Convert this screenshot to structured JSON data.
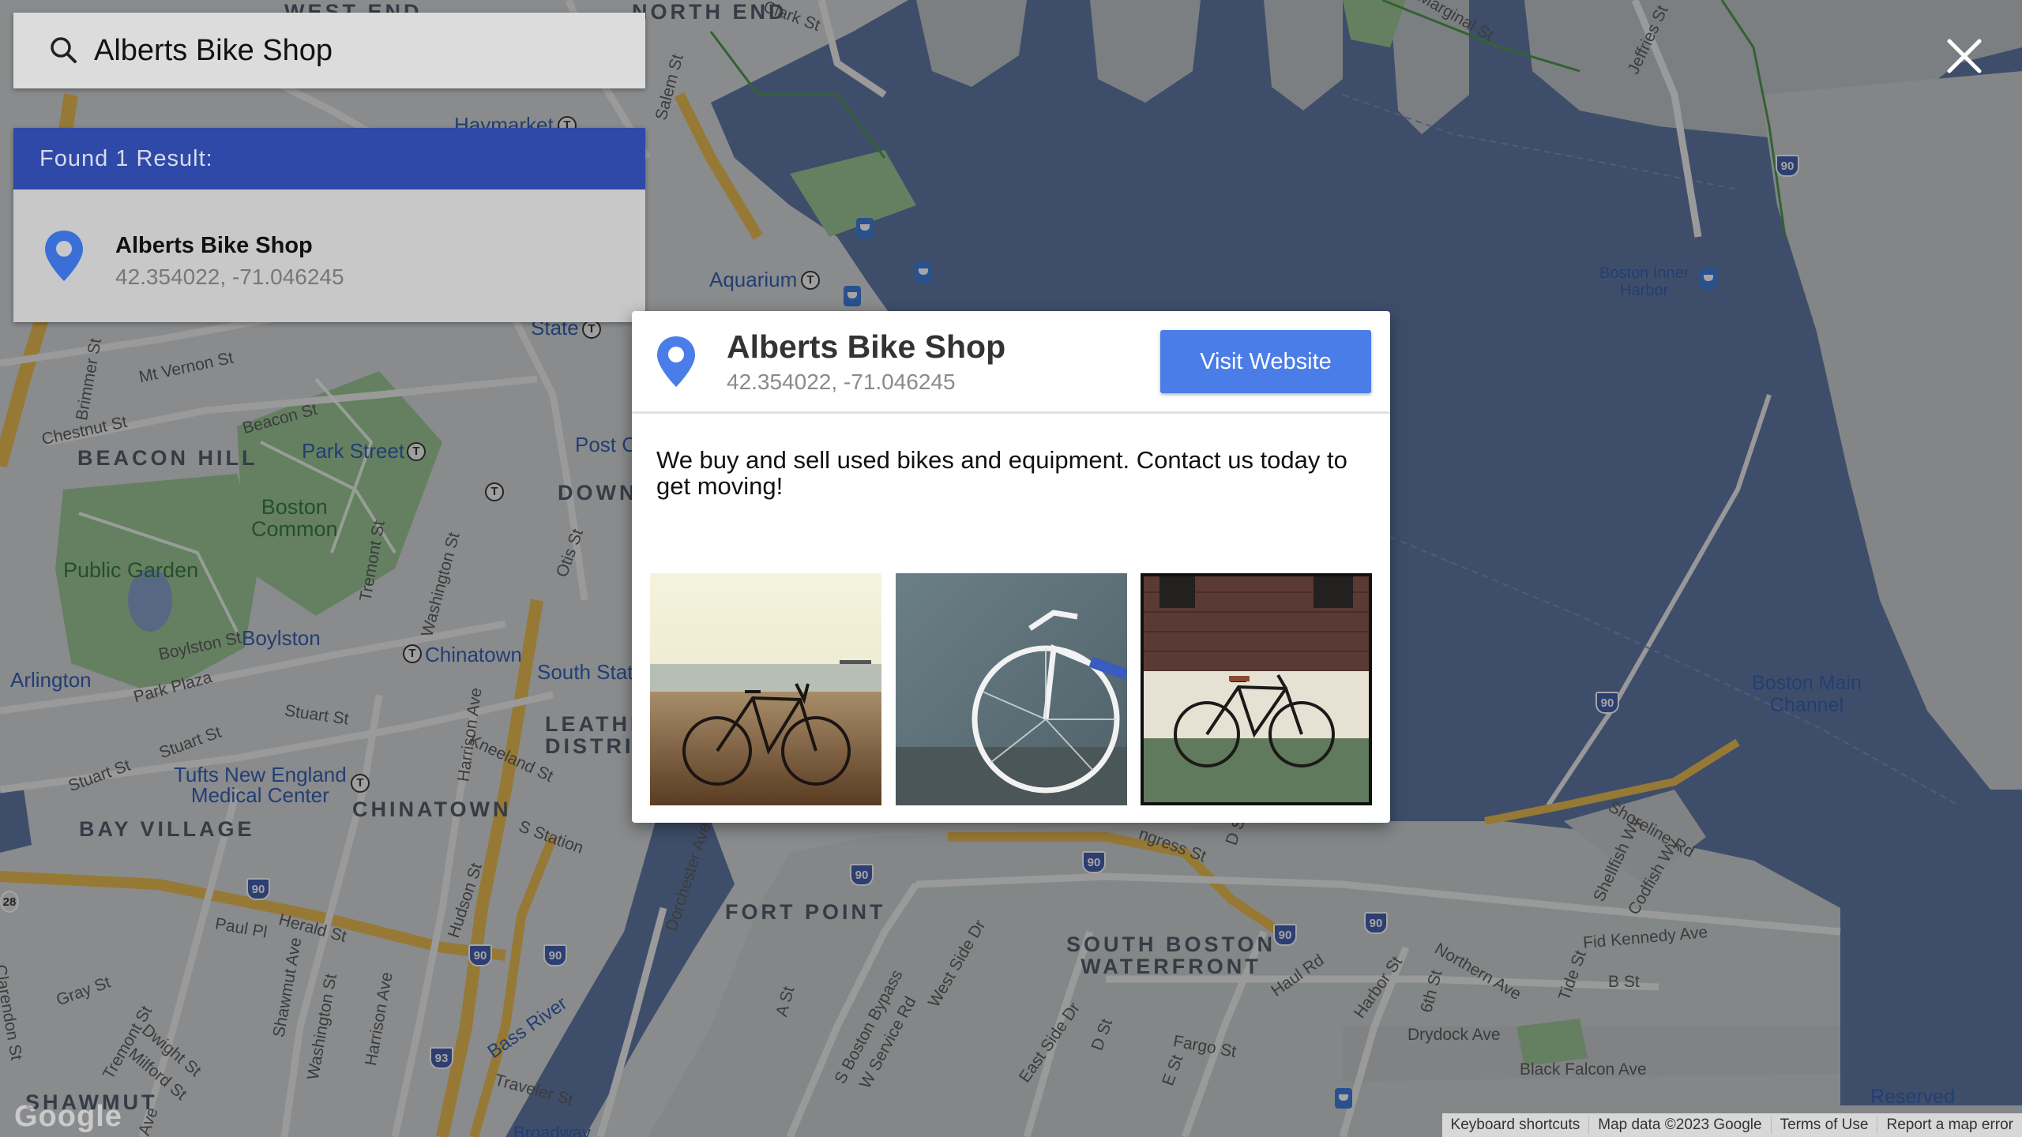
{
  "search": {
    "query": "Alberts Bike Shop"
  },
  "results": {
    "header": "Found 1 Result:",
    "items": [
      {
        "title": "Alberts Bike Shop",
        "coords": "42.354022, -71.046245"
      }
    ]
  },
  "modal": {
    "title": "Alberts Bike Shop",
    "coords": "42.354022, -71.046245",
    "visit_label": "Visit Website",
    "description": "We buy and sell used bikes and equipment. Contact us today to get moving!",
    "photos": [
      {
        "name": "bike-on-beach"
      },
      {
        "name": "white-bike-against-wall"
      },
      {
        "name": "bike-against-brick-wall",
        "selected": true
      }
    ]
  },
  "map": {
    "labels": {
      "west_end": "WEST END",
      "north_end": "NORTH END",
      "haymarket": "Haymarket",
      "aquarium": "Aquarium",
      "state": "State",
      "beacon_hill": "BEACON HILL",
      "park_street": "Park Street",
      "post": "Post C",
      "downtown": "DOWN",
      "boston_common": "Boston\nCommon",
      "public_garden": "Public Garden",
      "boylston": "Boylston",
      "chinatown_station": "Chinatown",
      "south_station": "South Stat",
      "arlington": "Arlington",
      "leather_district": "LEATHE\nDISTRIC",
      "tufts": "Tufts New England\nMedical Center",
      "chinatown": "CHINATOWN",
      "bay_village": "BAY VILLAGE",
      "fort_point": "FORT POINT",
      "south_boston_waterfront": "SOUTH BOSTON\nWATERFRONT",
      "shawmut": "SHAWMUT",
      "boston_inner_harbor": "Boston Inner\nHarbor",
      "boston_main_channel": "Boston Main\nChannel",
      "reserved_channel": "Reserved",
      "bass_river": "Bass River",
      "mt_vernon": "Mt Vernon St",
      "chestnut": "Chestnut St",
      "beacon_st": "Beacon St",
      "boylston_st": "Boylston St",
      "park_plaza": "Park Plaza",
      "stuart_st": "Stuart St",
      "stuart_st2": "Stuart St",
      "stuart_st3": "Stuart St",
      "kneeland": "Kneeland St",
      "harrison": "Harrison Ave",
      "herald": "Herald St",
      "paul_pl": "Paul Pl",
      "gray_st": "Gray St",
      "haul_rd": "Haul Rd",
      "harbor_st": "Harbor St",
      "drydock": "Drydock Ave",
      "black_falcon": "Black Falcon Ave",
      "fid_kennedy": "Fid Kennedy Ave",
      "northern_ave": "Northern Ave",
      "shoreline": "Shoreline Rd",
      "b_st": "B St",
      "d_st": "D St",
      "a_st": "A St",
      "fargo": "Fargo St",
      "traveler": "Traveler St",
      "broadway": "Broadway",
      "tremont": "Tremont St",
      "washington": "Washington St",
      "clarendon": "Clarendon St",
      "clark_st": "Clark St",
      "salem_st": "Salem St",
      "jeffries": "Jeffries St",
      "marginal": "Marginal St",
      "brimmer": "Brimmer St",
      "charles": "St",
      "s_station": "S Station",
      "hudson": "Hudson St",
      "dorchester": "Dorchester Ave",
      "congress": "ngress St",
      "west_side": "West Side Dr",
      "east_side": "East Side Dr",
      "bypass": "S Boston Bypass",
      "service_rd": "W Service Rd",
      "e_st": "E St",
      "sixth_st": "6th St",
      "tide_st": "Tide St",
      "shellfish": "Shellfish Wy",
      "codfish": "Codfish Wy",
      "summer": "D St",
      "otis": "Otis St",
      "dwight": "Dwight St",
      "milford": "Milford St",
      "shawmut_ave": "Shawmut Ave",
      "ave": "Ave"
    },
    "shields": [
      "90",
      "90",
      "90",
      "90",
      "90",
      "90",
      "90",
      "93",
      "28"
    ]
  },
  "footer": {
    "google": "Google",
    "keyboard": "Keyboard shortcuts",
    "map_data": "Map data ©2023 Google",
    "terms": "Terms of Use",
    "report": "Report a map error"
  },
  "colors": {
    "results_header": "#2f49a8",
    "visit_button": "#4b7de8",
    "pin": "#3a6fd8",
    "water": "#4e6a9a"
  }
}
